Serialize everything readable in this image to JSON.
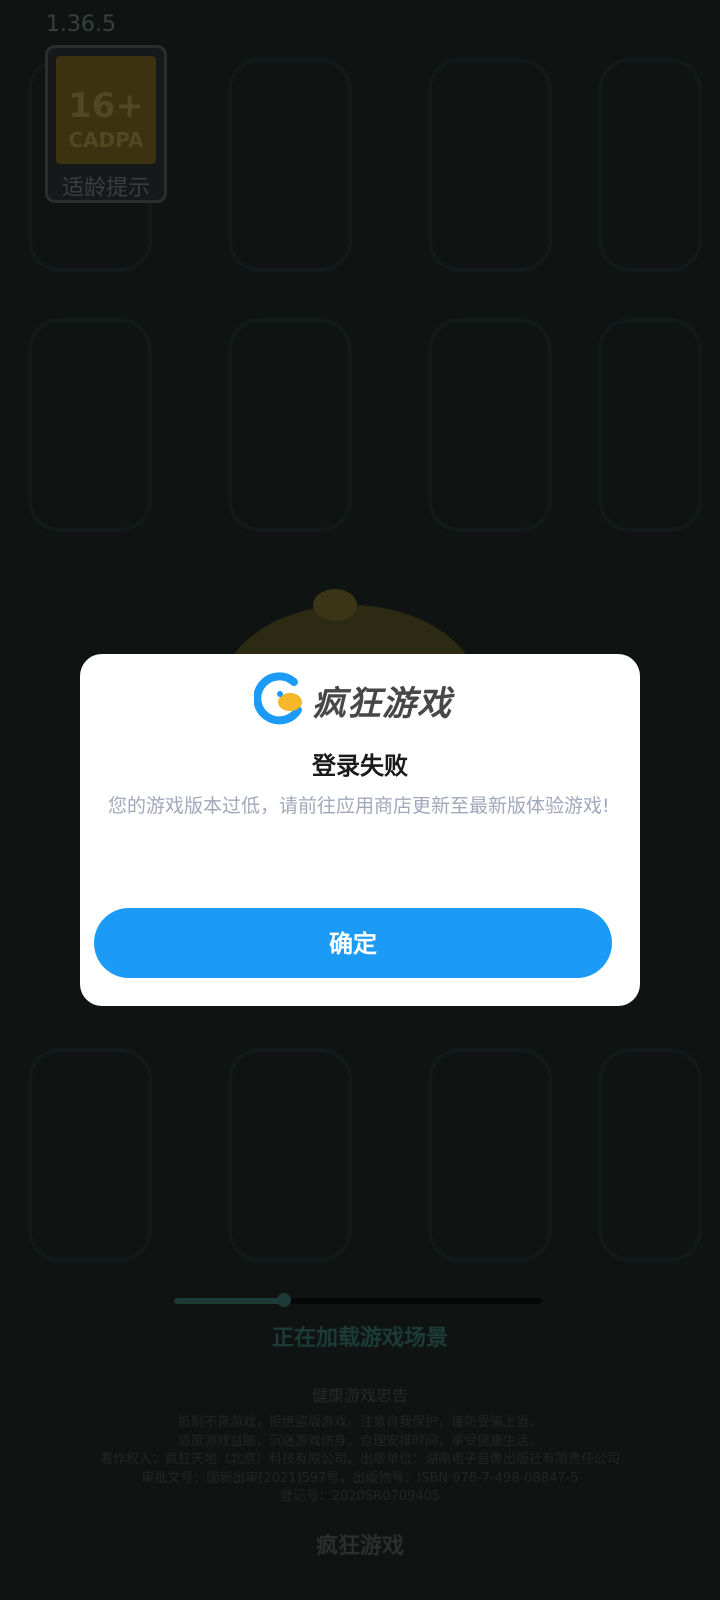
{
  "app": {
    "version": "1.36.5",
    "age_rating": {
      "number": "16+",
      "org": "CADPA",
      "label": "适龄提示"
    }
  },
  "loading": {
    "text": "正在加载游戏场景",
    "progress_fraction": 0.3
  },
  "health_notice": {
    "title": "健康游戏忠告",
    "lines": [
      "抵制不良游戏，拒绝盗版游戏。注意自我保护，谨防受骗上当。",
      "适度游戏益脑，沉迷游戏伤身。合理安排时间，享受健康生活。",
      "著作权人：疯狂天地（北京）科技有限公司。出版单位：湖南电子音像出版社有限责任公司",
      "审批文号：国新出审[2021]597号，出版物号：ISBN 978-7-498-08847-5",
      "登记号：2020SR0709405"
    ]
  },
  "footer": {
    "brand": "疯狂游戏"
  },
  "dialog": {
    "brand": "疯狂游戏",
    "title": "登录失败",
    "message": "您的游戏版本过低，请前往应用商店更新至最新版体验游戏!",
    "confirm_label": "确定"
  },
  "colors": {
    "background": "#0f1413",
    "dialog_bg": "#ffffff",
    "button": "#1c9bf6",
    "logo_blue": "#1c9bf6",
    "logo_yellow": "#f6b72a"
  }
}
